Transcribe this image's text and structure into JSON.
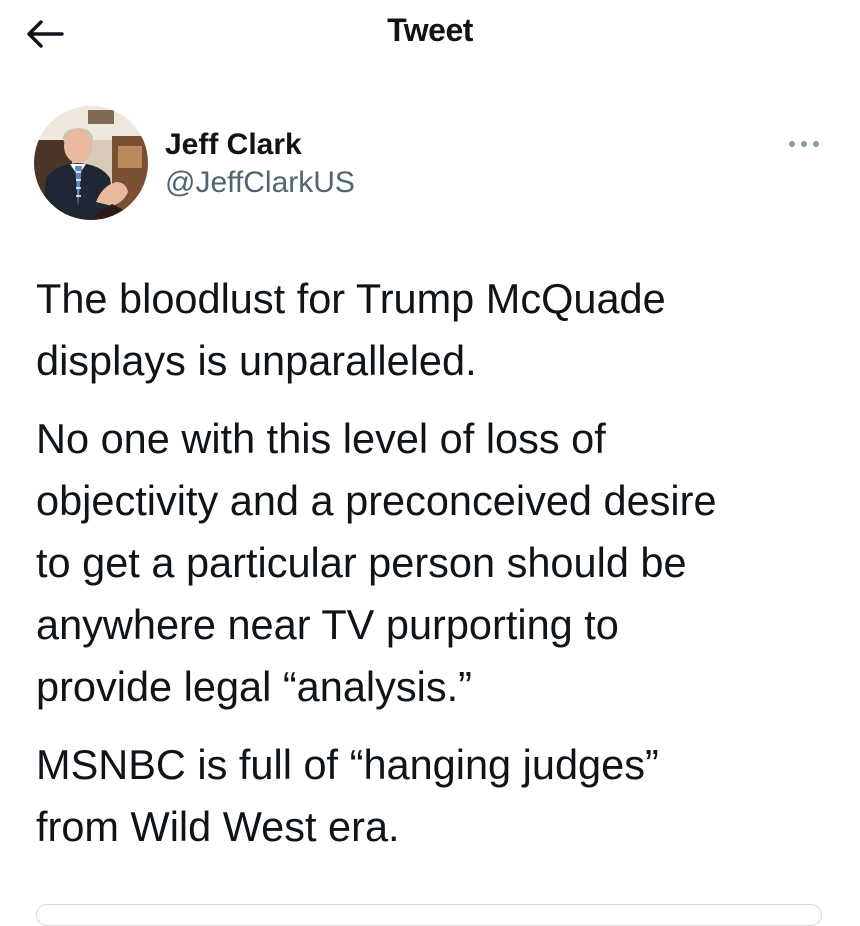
{
  "header": {
    "title": "Tweet",
    "back_icon": "arrow-left-icon"
  },
  "author": {
    "name": "Jeff Clark",
    "handle": "@JeffClarkUS",
    "avatar": "profile-photo",
    "more_icon": "more-horizontal-icon"
  },
  "tweet": {
    "paragraphs": [
      [
        "The bloodlust for Trump McQuade",
        "displays is unparalleled."
      ],
      [
        "No one with this level of loss of",
        "objectivity and a preconceived desire",
        "to get a particular person should be",
        "anywhere near TV purporting to",
        "provide legal “analysis.”"
      ],
      [
        "MSNBC is full of “hanging judges”",
        "from Wild West era."
      ]
    ]
  },
  "colors": {
    "text": "#0f1419",
    "secondary": "#536471",
    "background": "#ffffff",
    "border": "#cfd9de"
  }
}
